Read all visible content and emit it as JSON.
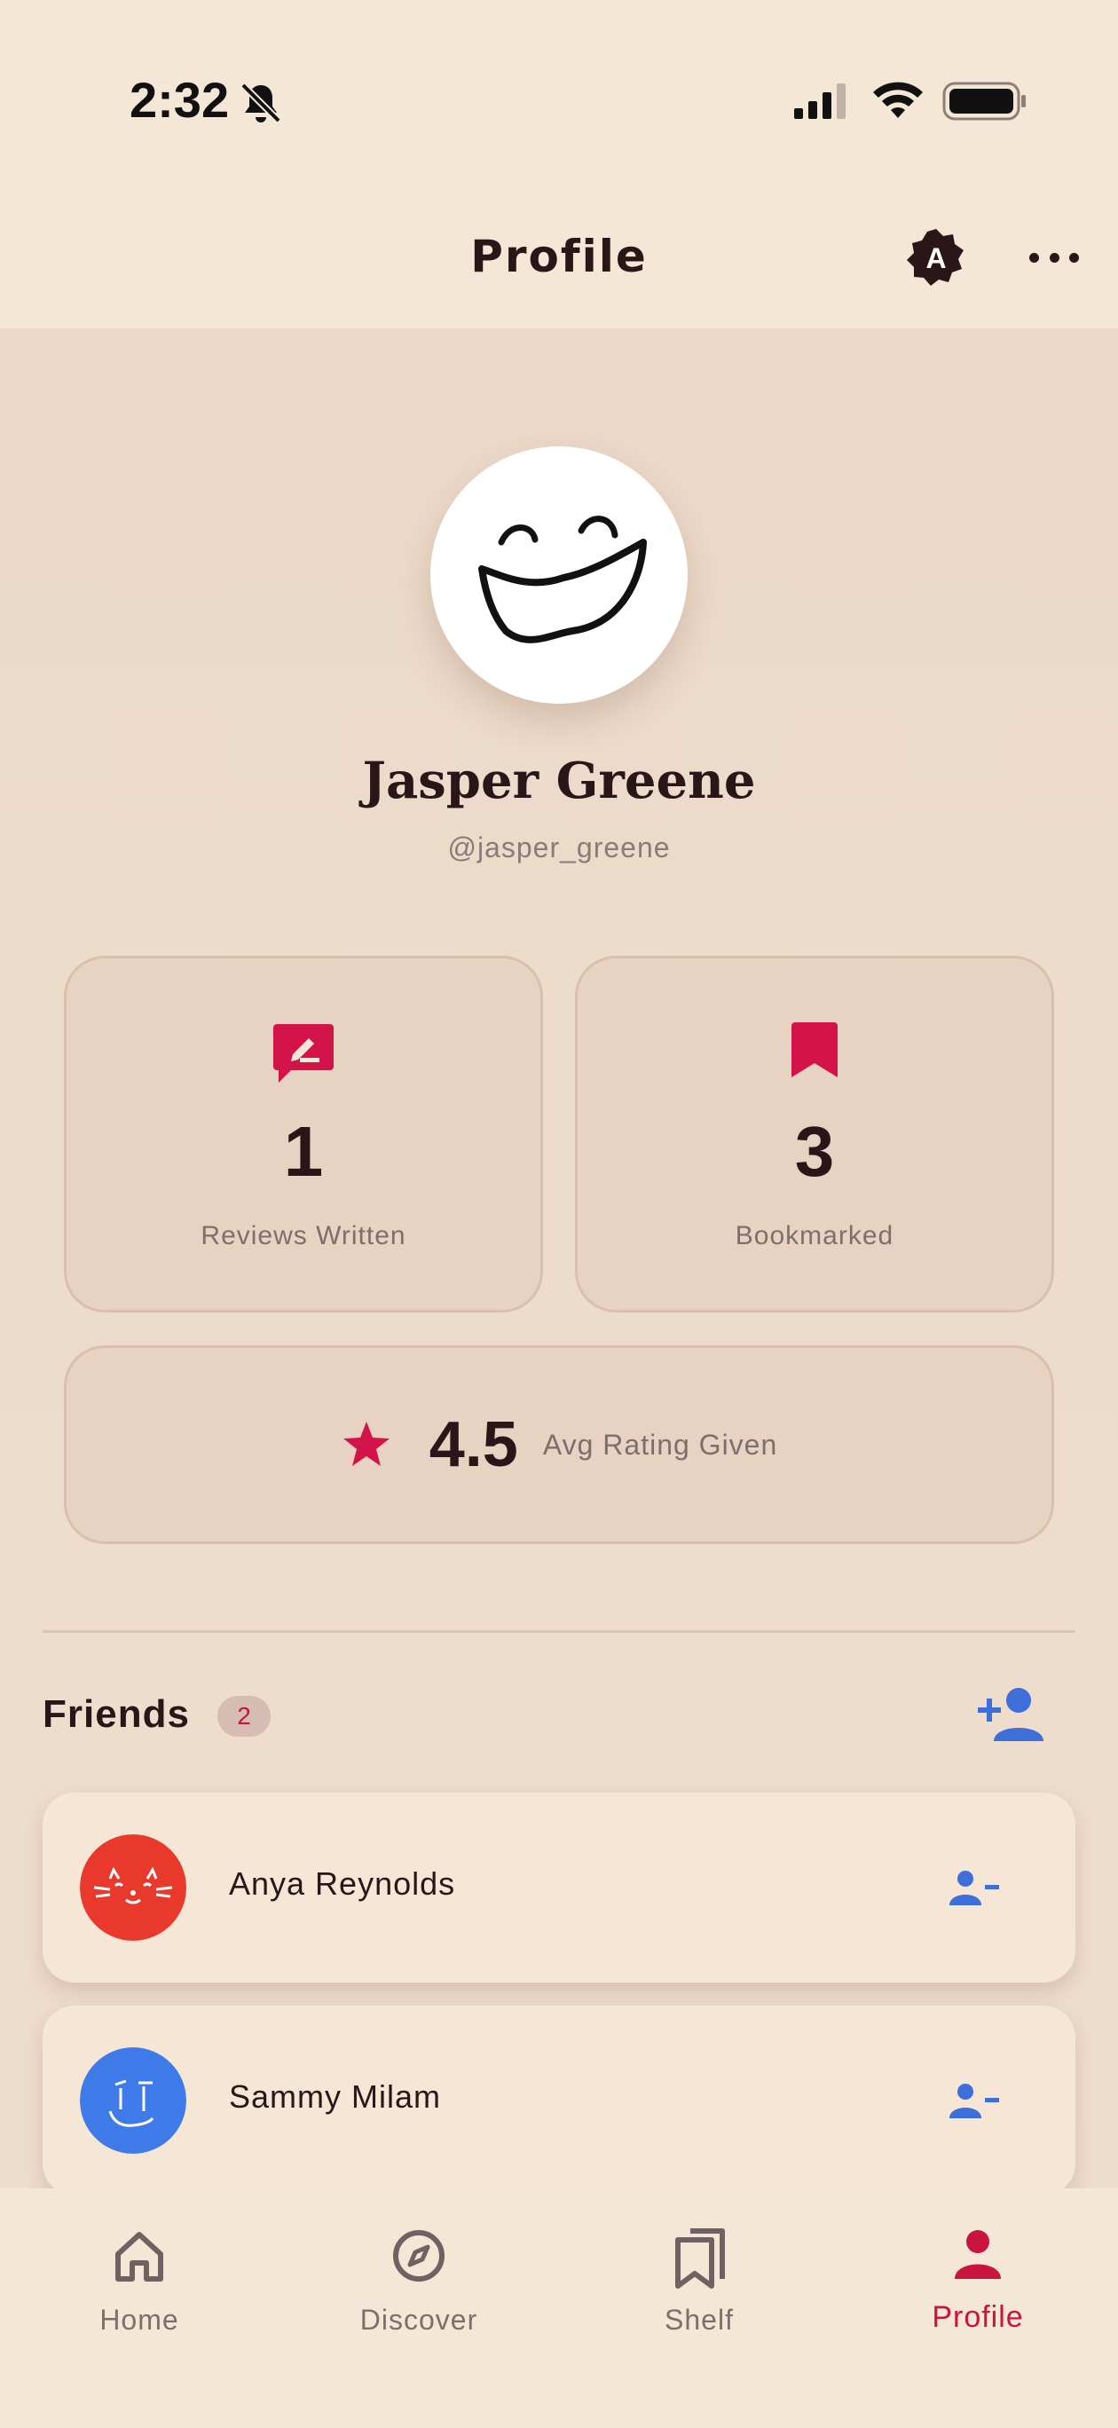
{
  "status_bar": {
    "time": "2:32"
  },
  "header": {
    "title": "Profile",
    "badge_letter": "A"
  },
  "profile": {
    "name": "Jasper Greene",
    "handle": "@jasper_greene"
  },
  "stats": {
    "reviews": {
      "value": "1",
      "label": "Reviews Written"
    },
    "bookmarks": {
      "value": "3",
      "label": "Bookmarked"
    },
    "rating": {
      "value": "4.5",
      "label": "Avg Rating Given"
    }
  },
  "friends": {
    "title": "Friends",
    "count": "2",
    "items": [
      {
        "name": "Anya Reynolds",
        "avatar_color": "#e8392c"
      },
      {
        "name": "Sammy Milam",
        "avatar_color": "#3f7be8"
      }
    ]
  },
  "nav": {
    "home": "Home",
    "discover": "Discover",
    "shelf": "Shelf",
    "profile": "Profile"
  },
  "colors": {
    "accent": "#c8143e",
    "action_blue": "#3e6fd8",
    "background": "#f5e7d6"
  },
  "icons": {
    "header": [
      "a-badge-icon",
      "more-icon"
    ],
    "stats": [
      "review-icon",
      "bookmark-icon",
      "star-icon"
    ],
    "friends": [
      "add-friend-icon",
      "remove-friend-icon"
    ],
    "nav": [
      "home-icon",
      "compass-icon",
      "shelf-icon",
      "person-icon"
    ]
  }
}
